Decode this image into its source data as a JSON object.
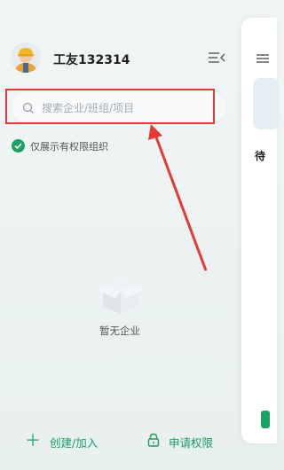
{
  "user": {
    "name": "工友132314"
  },
  "search": {
    "placeholder": "搜索企业/班组/项目"
  },
  "filter": {
    "label": "仅展示有权限组织",
    "checked": true
  },
  "empty_state": {
    "text": "暂无企业"
  },
  "footer": {
    "create_label": "创建/加入",
    "apply_label": "申请权限"
  },
  "panel": {
    "pending_label": "待"
  },
  "colors": {
    "accent": "#1aa163",
    "annotation": "#e53935"
  },
  "icons": {
    "avatar": "worker-avatar-icon",
    "collapse": "menu-collapse-icon",
    "search": "search-icon",
    "filter": "check-circle-icon",
    "empty": "empty-box-icon",
    "create": "plus-icon",
    "apply": "lock-icon"
  }
}
